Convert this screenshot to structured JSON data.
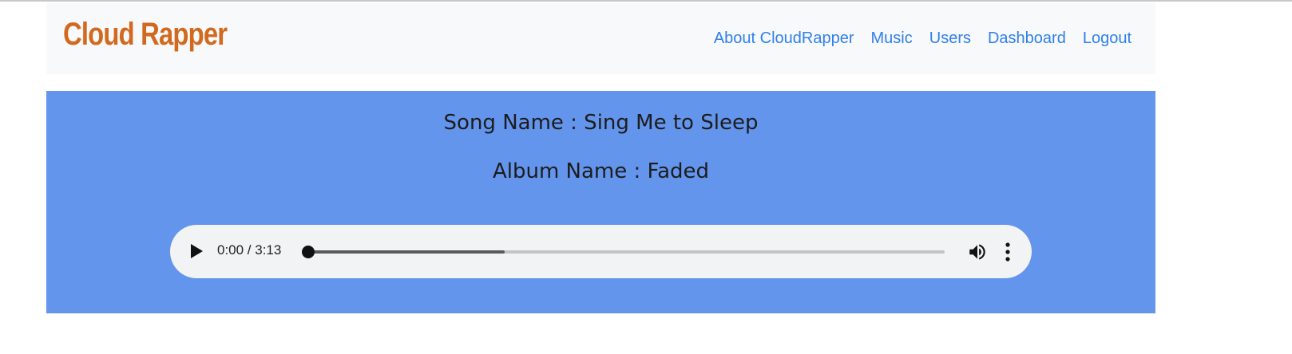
{
  "navbar": {
    "brand": "Cloud Rapper",
    "links": [
      "About CloudRapper",
      "Music",
      "Users",
      "Dashboard",
      "Logout"
    ]
  },
  "song": {
    "song_line": "Song Name : Sing Me to Sleep",
    "album_line": "Album Name : Faded"
  },
  "player": {
    "time": "0:00 / 3:13",
    "played_fraction": 0.0,
    "buffered_fraction": 0.31,
    "icons": [
      "play-icon",
      "volume-icon",
      "more-options-icon"
    ]
  },
  "colors": {
    "brand": "#d2691e",
    "link": "#2f80ed",
    "panel": "#6495ed",
    "navbar_bg": "#f8f9fa",
    "player_bg": "#f1f3f4"
  }
}
